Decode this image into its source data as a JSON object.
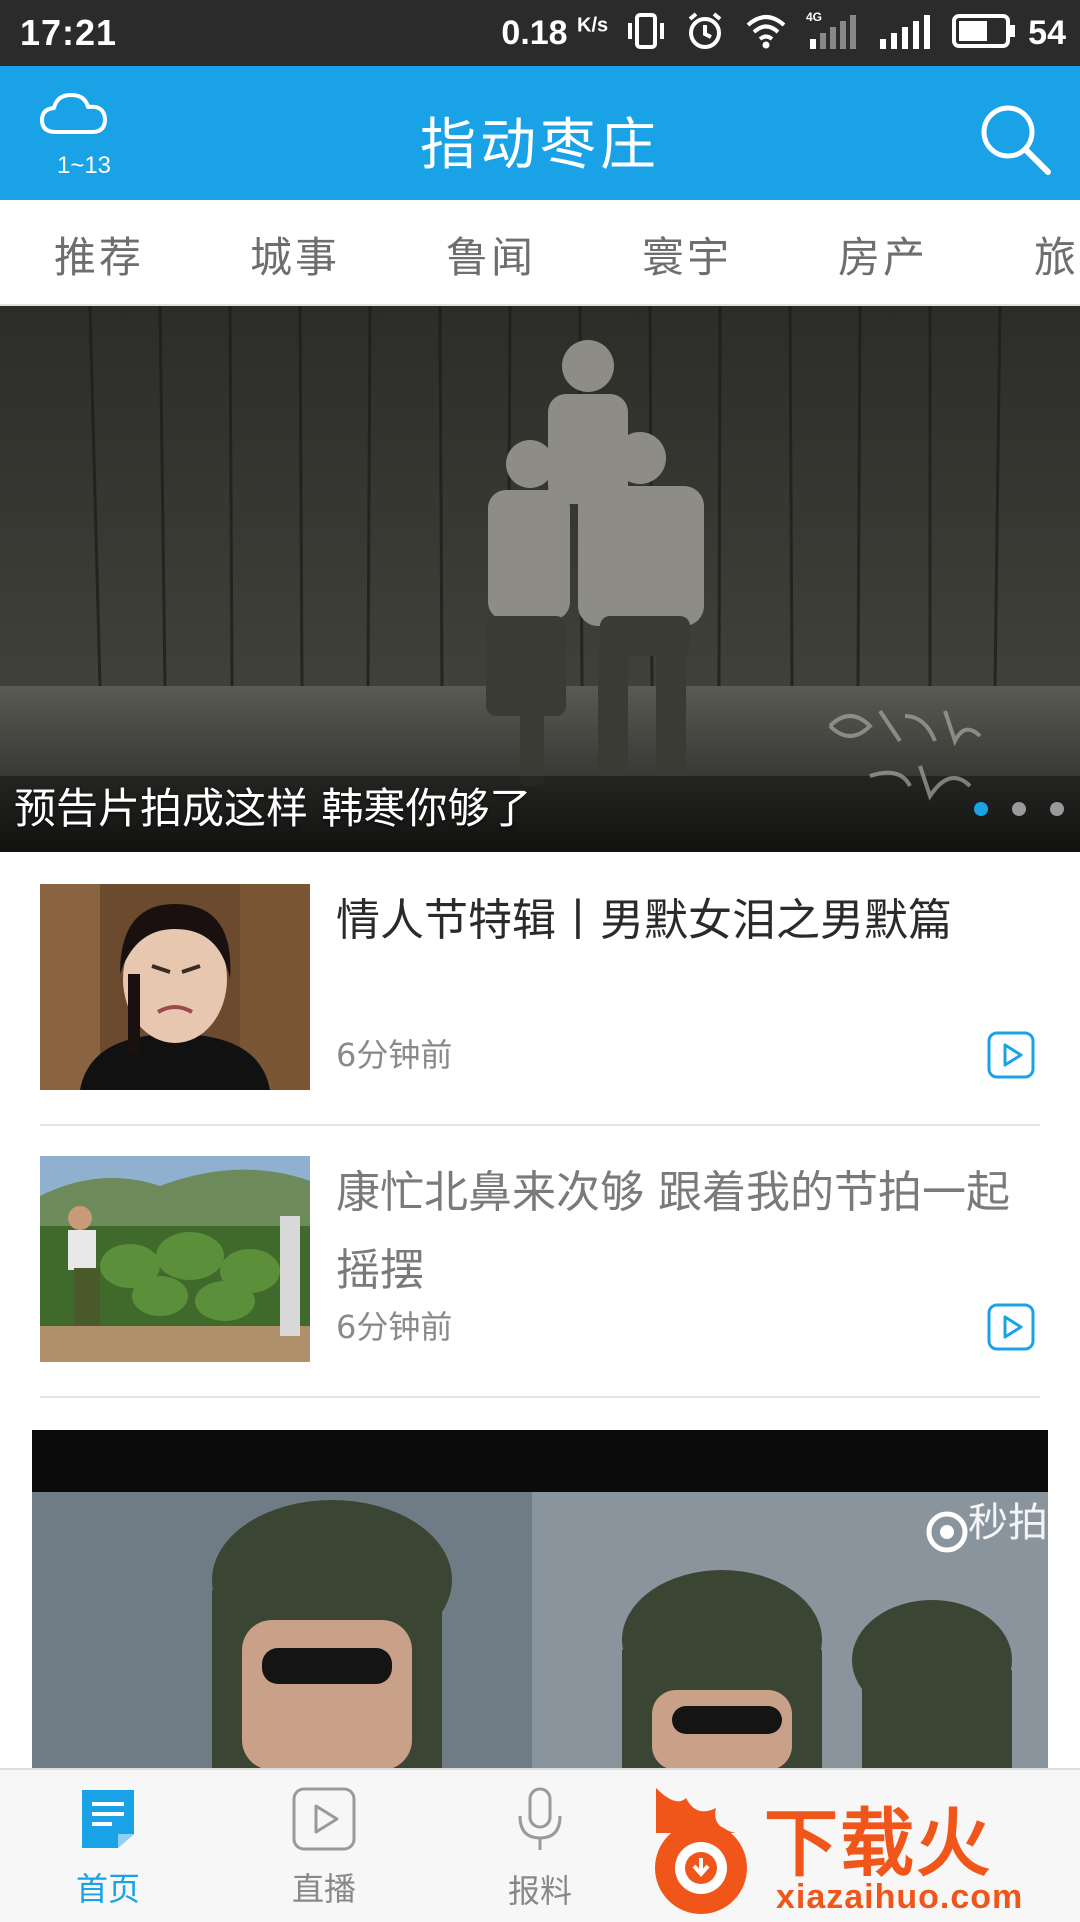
{
  "status_bar": {
    "time": "17:21",
    "net_speed": "0.18",
    "net_unit": "K/s",
    "network_type": "4G",
    "battery": "54",
    "icons": [
      "vibrate-icon",
      "alarm-icon",
      "wifi-icon",
      "signal-4g-icon",
      "signal-icon",
      "battery-icon"
    ]
  },
  "header": {
    "weather": {
      "icon": "cloud-icon",
      "temp": "1~13"
    },
    "title": "指动枣庄",
    "search_icon": "search-icon"
  },
  "tabs": [
    "推荐",
    "城事",
    "鲁闻",
    "寰宇",
    "房产",
    "旅"
  ],
  "hero": {
    "caption": "预告片拍成这样 韩寒你够了",
    "dots": 3,
    "active_dot": 0
  },
  "news": [
    {
      "title": "情人节特辑丨男默女泪之男默篇",
      "time": "6分钟前",
      "icon": "play-icon",
      "read": false
    },
    {
      "title": "康忙北鼻来次够 跟着我的节拍一起摇摆",
      "time": "6分钟前",
      "icon": "play-icon",
      "read": true
    }
  ],
  "video_card": {
    "watermark": "秒拍"
  },
  "bottom_nav": [
    {
      "label": "首页",
      "icon": "home-doc-icon",
      "active": true
    },
    {
      "label": "直播",
      "icon": "live-play-icon",
      "active": false
    },
    {
      "label": "报料",
      "icon": "microphone-icon",
      "active": false
    }
  ],
  "brand_overlay": {
    "text": "下载火",
    "url": "xiazaihuo.com"
  },
  "colors": {
    "accent": "#1aa2e6",
    "brand": "#f0561a"
  }
}
